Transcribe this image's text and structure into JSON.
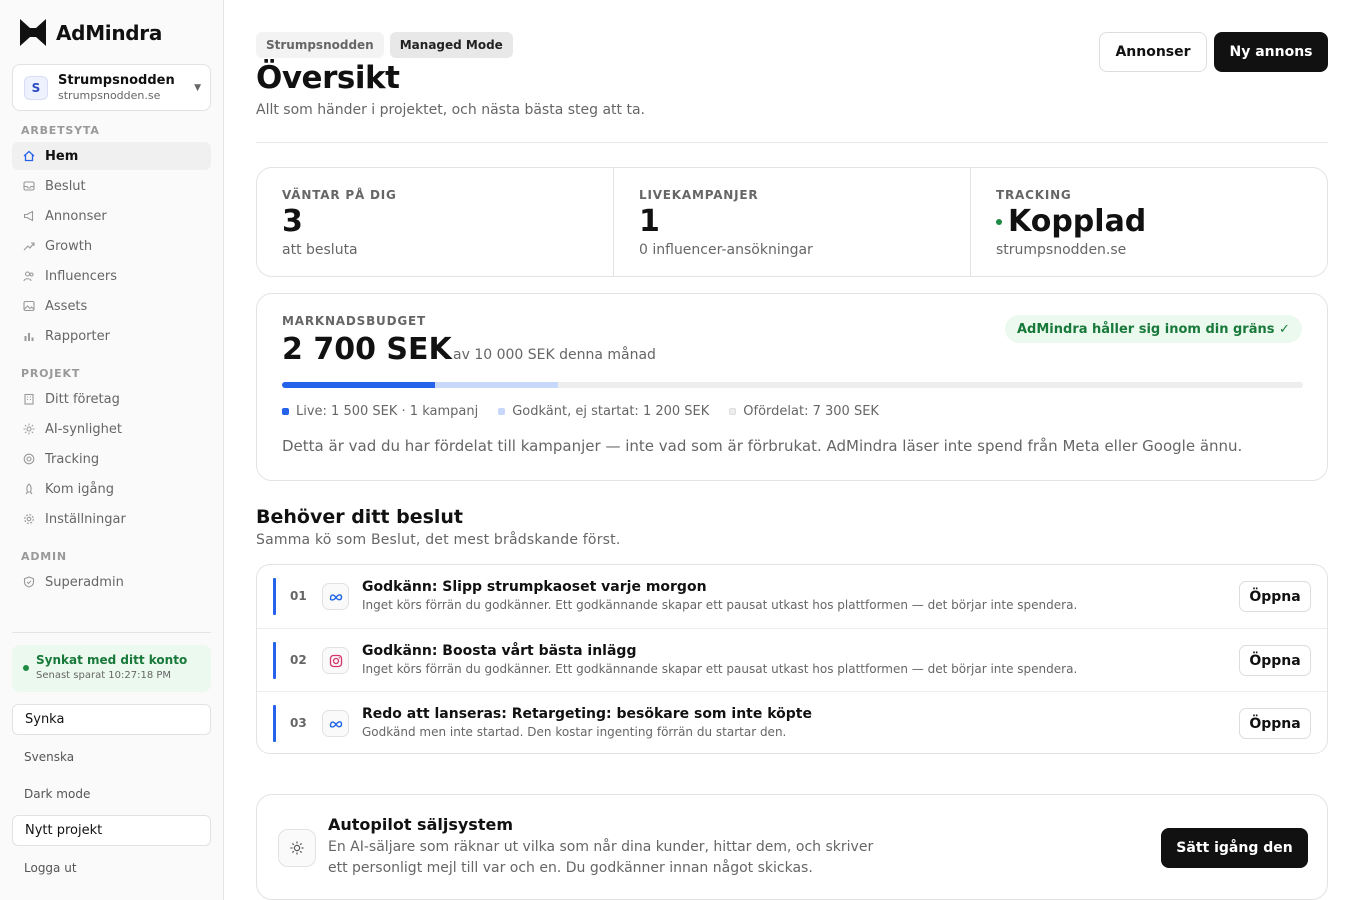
{
  "app": {
    "name": "AdMindra"
  },
  "project": {
    "initial": "S",
    "name": "Strumpsnodden",
    "domain": "strumpsnodden.se"
  },
  "sidebar": {
    "sections": {
      "workspace": "ARBETSYTA",
      "project": "PROJEKT",
      "admin": "ADMIN"
    },
    "workspace_items": [
      {
        "label": "Hem",
        "icon": "home-icon"
      },
      {
        "label": "Beslut",
        "icon": "inbox-icon"
      },
      {
        "label": "Annonser",
        "icon": "megaphone-icon"
      },
      {
        "label": "Growth",
        "icon": "trend-icon"
      },
      {
        "label": "Influencers",
        "icon": "users-icon"
      },
      {
        "label": "Assets",
        "icon": "image-icon"
      },
      {
        "label": "Rapporter",
        "icon": "bar-chart-icon"
      }
    ],
    "project_items": [
      {
        "label": "Ditt företag",
        "icon": "building-icon"
      },
      {
        "label": "AI-synlighet",
        "icon": "sparkle-icon"
      },
      {
        "label": "Tracking",
        "icon": "target-icon"
      },
      {
        "label": "Kom igång",
        "icon": "rocket-icon"
      },
      {
        "label": "Inställningar",
        "icon": "gear-icon"
      }
    ],
    "admin_items": [
      {
        "label": "Superadmin",
        "icon": "shield-icon"
      }
    ],
    "sync": {
      "title": "Synkat med ditt konto",
      "subtitle": "Senast sparat 10:27:18 PM"
    },
    "sync_button": "Synka",
    "language": "Svenska",
    "dark_mode": "Dark mode",
    "new_project": "Nytt projekt",
    "logout": "Logga ut"
  },
  "header": {
    "breadcrumb": [
      "Strumpsnodden",
      "Managed Mode"
    ],
    "title": "Översikt",
    "subtitle": "Allt som händer i projektet, och nästa bästa steg att ta.",
    "btn_ads": "Annonser",
    "btn_new_ad": "Ny annons"
  },
  "stats": [
    {
      "label": "VÄNTAR PÅ DIG",
      "value": "3",
      "sub": "att besluta"
    },
    {
      "label": "LIVEKAMPANJER",
      "value": "1",
      "sub": "0 influencer-ansökningar"
    },
    {
      "label": "TRACKING",
      "value": "Kopplad",
      "sub": "strumpsnodden.se"
    }
  ],
  "budget": {
    "label": "MARKNADSBUDGET",
    "amount": "2 700 SEK",
    "of_text": "av 10 000 SEK denna månad",
    "badge": "AdMindra håller sig inom din gräns ✓",
    "total": 10000,
    "live": 1500,
    "approved": 1200,
    "legend": [
      "Live: 1 500 SEK · 1 kampanj",
      "Godkänt, ej startat: 1 200 SEK",
      "Ofördelat: 7 300 SEK"
    ],
    "colors": {
      "live": "#2563eb",
      "approved": "#c7d8fb",
      "unallocated": "#eeeeee"
    },
    "note": "Detta är vad du har fördelat till kampanjer — inte vad som är förbrukat. AdMindra läser inte spend från Meta eller Google ännu."
  },
  "decisions": {
    "title": "Behöver ditt beslut",
    "subtitle": "Samma kö som Beslut, det mest brådskande först.",
    "open_label": "Öppna",
    "items": [
      {
        "num": "01",
        "platform": "meta-icon",
        "title": "Godkänn: Slipp strumpkaoset varje morgon",
        "desc": "Inget körs förrän du godkänner. Ett godkännande skapar ett pausat utkast hos plattformen — det börjar inte spendera."
      },
      {
        "num": "02",
        "platform": "instagram-icon",
        "title": "Godkänn: Boosta vårt bästa inlägg",
        "desc": "Inget körs förrän du godkänner. Ett godkännande skapar ett pausat utkast hos plattformen — det börjar inte spendera."
      },
      {
        "num": "03",
        "platform": "meta-icon",
        "title": "Redo att lanseras: Retargeting: besökare som inte köpte",
        "desc": "Godkänd men inte startad. Den kostar ingenting förrän du startar den."
      }
    ]
  },
  "autopilot": {
    "title": "Autopilot säljsystem",
    "desc": "En AI-säljare som räknar ut vilka som når dina kunder, hittar dem, och skriver ett personligt mejl till var och en. Du godkänner innan något skickas.",
    "button": "Sätt igång den"
  }
}
